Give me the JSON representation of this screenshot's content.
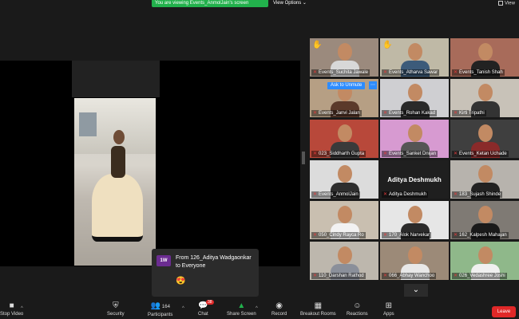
{
  "banner": {
    "viewing_text": "You are viewing Events_AnmolJain's screen",
    "view_options": "View Options",
    "view_label": "View"
  },
  "grid": {
    "tiles": [
      {
        "name": "Events_Suchita Jawale",
        "hand": true
      },
      {
        "name": "Events_Atharva Sawar",
        "hand": true
      },
      {
        "name": "Events_Tanish Shah"
      },
      {
        "name": "Events_Janvi Jalan",
        "unmute": "Ask to Unmute"
      },
      {
        "name": "Events_Rohan Kakad"
      },
      {
        "name": "Kirti Tripathi"
      },
      {
        "name": "023_Siddharth Gupta"
      },
      {
        "name": "Events_Sanket Dnijan"
      },
      {
        "name": "Events_Ketan Uchade"
      },
      {
        "name": "Events_AnmolJain"
      },
      {
        "name": "Aditya Deshmukh",
        "big": "Aditya Deshmukh"
      },
      {
        "name": "183_Sujash Shinde"
      },
      {
        "name": "050_Cindy Rayca Ro"
      },
      {
        "name": "170_Alok Narvekar"
      },
      {
        "name": "162_Kalpesh Mahajan"
      },
      {
        "name": "110_Darshan Rathod"
      },
      {
        "name": "066_Abhay Wanchoo"
      },
      {
        "name": "026_Vedashree Joshi"
      }
    ]
  },
  "chat": {
    "avatar": "1W",
    "text": "From 126_Aditya Wadgaonkar to Everyone",
    "emoji": "😍"
  },
  "toolbar": {
    "video": "Stop Video",
    "security": "Security",
    "participants": "Participants",
    "participants_count": "164",
    "chat": "Chat",
    "chat_badge": "38",
    "share": "Share Screen",
    "record": "Record",
    "breakout": "Breakout Rooms",
    "reactions": "Reactions",
    "apps": "Apps",
    "leave": "Leave"
  },
  "colors": {
    "accent_green": "#22b14c",
    "leave_red": "#e02828",
    "zoom_blue": "#2d8cff",
    "active_outline": "#d9e54a"
  }
}
